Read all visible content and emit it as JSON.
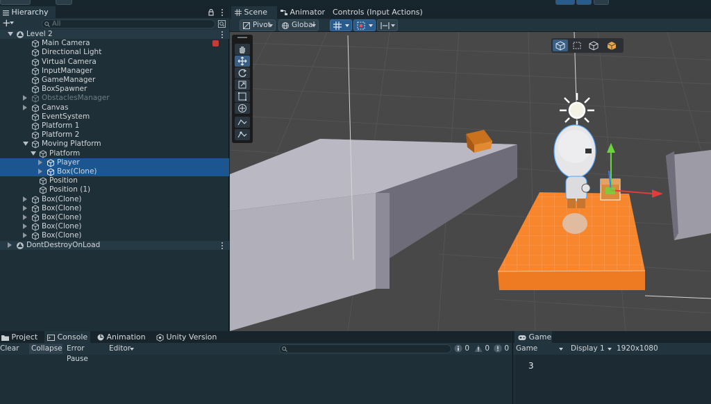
{
  "hierarchy": {
    "tab_label": "Hierarchy",
    "add_label": "+",
    "search_placeholder": "All",
    "rows": [
      {
        "label": "Level 2",
        "depth": 0,
        "arrow": "down",
        "type": "scene"
      },
      {
        "label": "Main Camera",
        "depth": 2,
        "arrow": "none",
        "type": "object"
      },
      {
        "label": "Directional Light",
        "depth": 2,
        "arrow": "none",
        "type": "object"
      },
      {
        "label": "Virtual Camera",
        "depth": 2,
        "arrow": "none",
        "type": "object"
      },
      {
        "label": "InputManager",
        "depth": 2,
        "arrow": "none",
        "type": "object"
      },
      {
        "label": "GameManager",
        "depth": 2,
        "arrow": "none",
        "type": "object"
      },
      {
        "label": "BoxSpawner",
        "depth": 2,
        "arrow": "none",
        "type": "object"
      },
      {
        "label": "ObstaclesManager",
        "depth": 2,
        "arrow": "right",
        "type": "dim"
      },
      {
        "label": "Canvas",
        "depth": 2,
        "arrow": "right",
        "type": "object"
      },
      {
        "label": "EventSystem",
        "depth": 2,
        "arrow": "none",
        "type": "object"
      },
      {
        "label": "Platform 1",
        "depth": 2,
        "arrow": "none",
        "type": "object"
      },
      {
        "label": "Platform 2",
        "depth": 2,
        "arrow": "none",
        "type": "object"
      },
      {
        "label": "Moving Platform",
        "depth": 2,
        "arrow": "down",
        "type": "object"
      },
      {
        "label": "Platform",
        "depth": 3,
        "arrow": "down",
        "type": "object"
      },
      {
        "label": "Player",
        "depth": 4,
        "arrow": "right",
        "type": "selected"
      },
      {
        "label": "Box(Clone)",
        "depth": 4,
        "arrow": "right",
        "type": "selected"
      },
      {
        "label": "Position",
        "depth": 3,
        "arrow": "none",
        "type": "object"
      },
      {
        "label": "Position (1)",
        "depth": 3,
        "arrow": "none",
        "type": "object"
      },
      {
        "label": "Box(Clone)",
        "depth": 2,
        "arrow": "right",
        "type": "object"
      },
      {
        "label": "Box(Clone)",
        "depth": 2,
        "arrow": "right",
        "type": "object"
      },
      {
        "label": "Box(Clone)",
        "depth": 2,
        "arrow": "right",
        "type": "object"
      },
      {
        "label": "Box(Clone)",
        "depth": 2,
        "arrow": "right",
        "type": "object"
      },
      {
        "label": "Box(Clone)",
        "depth": 2,
        "arrow": "right",
        "type": "object"
      },
      {
        "label": "DontDestroyOnLoad",
        "depth": 0,
        "arrow": "right",
        "type": "scene"
      }
    ]
  },
  "scene": {
    "tabs": [
      {
        "label": "Scene",
        "icon": "grid-icon"
      },
      {
        "label": "Animator",
        "icon": "animator-icon"
      },
      {
        "label": "Controls (Input Actions)",
        "icon": "none"
      }
    ],
    "toolbar": {
      "pivot_label": "Pivot",
      "global_label": "Global"
    }
  },
  "bottom": {
    "tabs": [
      {
        "label": "Project",
        "icon": "folder-icon"
      },
      {
        "label": "Console",
        "icon": "console-icon"
      },
      {
        "label": "Animation",
        "icon": "animation-icon"
      },
      {
        "label": "Unity Version Control",
        "icon": "version-control-icon"
      }
    ],
    "console": {
      "clear_label": "Clear",
      "collapse_label": "Collapse",
      "error_pause_label": "Error Pause",
      "editor_label": "Editor",
      "info_count": "0",
      "warning_count": "0",
      "error_count": "0"
    }
  },
  "game": {
    "tab_label": "Game",
    "mode_label": "Game",
    "display_label": "Display 1",
    "resolution_label": "1920x1080",
    "score_text": "3"
  },
  "colors": {
    "selection": "#1c5690",
    "panel": "#1e2f38",
    "platform_orange": "#f7862c"
  }
}
